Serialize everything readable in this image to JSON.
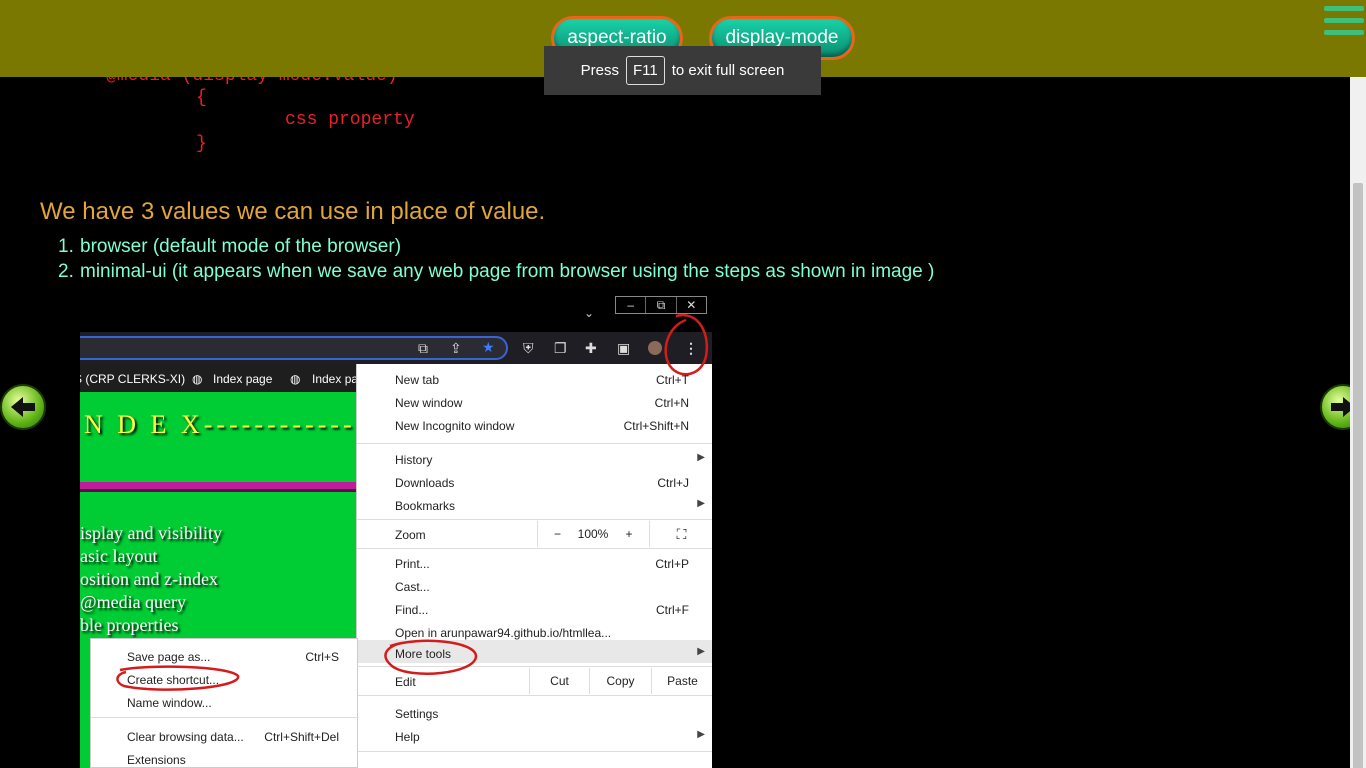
{
  "topbar": {
    "buttons": [
      "aspect-ratio",
      "display-mode"
    ]
  },
  "fullscreen_notice": {
    "prefix": "Press",
    "key": "F11",
    "suffix": "to exit full screen"
  },
  "code": {
    "line1": "@media (display-mode:value)",
    "line2": "{",
    "line3": "css property",
    "line4": "}"
  },
  "heading": "We have 3 values we can use in place of value.",
  "list": [
    {
      "num": "1.",
      "text": "browser (default mode of the browser)"
    },
    {
      "num": "2.",
      "text": "minimal-ui (it appears when we save any web page from browser using the steps as shown in image )"
    }
  ],
  "colors": {
    "topbar": "#7a7800",
    "code": "#e8202a",
    "heading": "#e0a63a",
    "list": "#7fffd4",
    "pill": "#0fb08c",
    "annotation": "#d41c1c"
  },
  "screenshot": {
    "window_buttons": [
      "–",
      "⧉",
      "✕"
    ],
    "bookmarks": [
      "S (CRP CLERKS-XI)",
      "Index page",
      "Index pa"
    ],
    "page_title": "N D E X--------------",
    "page_entries": [
      "isplay and visibility",
      "asic layout",
      "osition and z-index",
      "@media query",
      "ble properties"
    ],
    "menu": {
      "new_tab": {
        "label": "New tab",
        "shortcut": "Ctrl+T"
      },
      "new_window": {
        "label": "New window",
        "shortcut": "Ctrl+N"
      },
      "new_incognito": {
        "label": "New Incognito window",
        "shortcut": "Ctrl+Shift+N"
      },
      "history": {
        "label": "History"
      },
      "downloads": {
        "label": "Downloads",
        "shortcut": "Ctrl+J"
      },
      "bookmarks": {
        "label": "Bookmarks"
      },
      "zoom": {
        "label": "Zoom",
        "minus": "−",
        "value": "100%",
        "plus": "+"
      },
      "print": {
        "label": "Print...",
        "shortcut": "Ctrl+P"
      },
      "cast": {
        "label": "Cast..."
      },
      "find": {
        "label": "Find...",
        "shortcut": "Ctrl+F"
      },
      "open_in": {
        "label": "Open in arunpawar94.github.io/htmllea..."
      },
      "more_tools": {
        "label": "More tools"
      },
      "edit": {
        "label": "Edit",
        "cut": "Cut",
        "copy": "Copy",
        "paste": "Paste"
      },
      "settings": {
        "label": "Settings"
      },
      "help": {
        "label": "Help"
      }
    },
    "submenu": {
      "save_page": {
        "label": "Save page as...",
        "shortcut": "Ctrl+S"
      },
      "create_shortcut": {
        "label": "Create shortcut..."
      },
      "name_window": {
        "label": "Name window..."
      },
      "clear_data": {
        "label": "Clear browsing data...",
        "shortcut": "Ctrl+Shift+Del"
      },
      "extensions": {
        "label": "Extensions"
      }
    }
  }
}
